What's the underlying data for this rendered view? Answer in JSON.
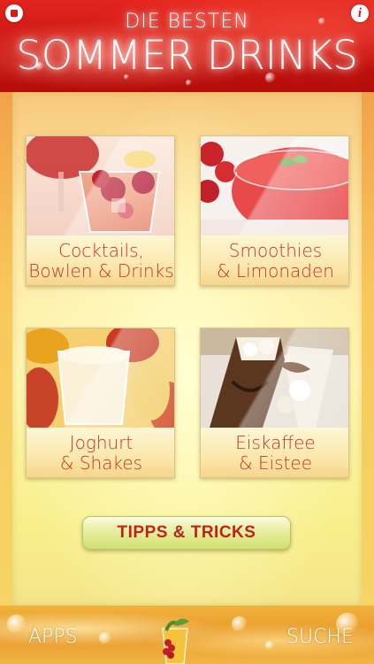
{
  "header": {
    "title_top": "DIE BESTEN",
    "title_main": "SOMMER DRINKS",
    "left_icon": "stop-square-icon",
    "right_icon": "info-icon",
    "info_glyph": "i",
    "accent_color": "#d81c16"
  },
  "tiles": [
    {
      "line1": "Cocktails,",
      "line2": "Bowlen & Drinks",
      "image": "cocktail-glass-raspberries"
    },
    {
      "line1": "Smoothies",
      "line2": "& Limonaden",
      "image": "strawberry-smoothie"
    },
    {
      "line1": "Joghurt",
      "line2": "& Shakes",
      "image": "mango-yogurt-shake"
    },
    {
      "line1": "Eiskaffee",
      "line2": "& Eistee",
      "image": "iced-coffee"
    }
  ],
  "tips_button": {
    "label": "TIPPS & TRICKS",
    "color": "#c0231c"
  },
  "footer": {
    "apps_label": "APPS",
    "search_label": "SUCHE",
    "center_icon": "fruit-drink-icon"
  }
}
